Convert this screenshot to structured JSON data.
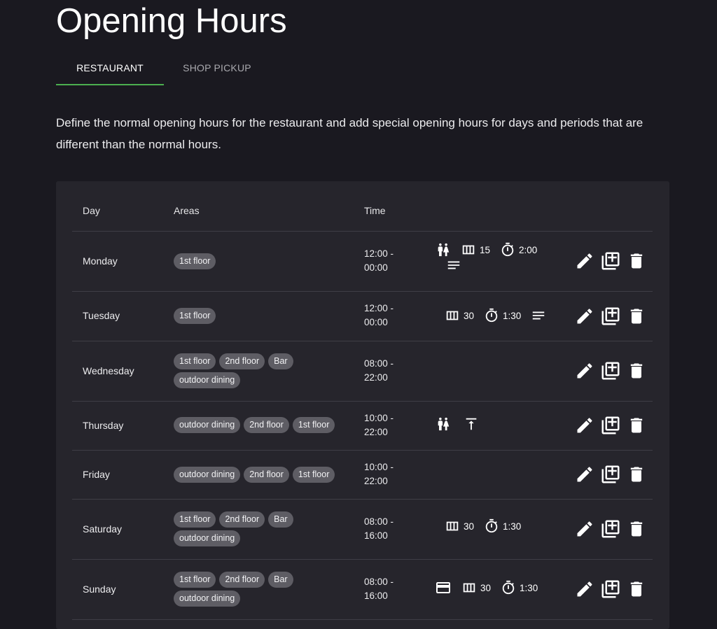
{
  "page": {
    "title": "Opening Hours",
    "description": "Define the normal opening hours for the restaurant and add special opening hours for days and periods that are different than the normal hours."
  },
  "tabs": [
    {
      "label": "RESTAURANT",
      "active": true
    },
    {
      "label": "SHOP PICKUP",
      "active": false
    }
  ],
  "colors": {
    "background": "#1a1920",
    "card": "#26252c",
    "accent": "#4caf50",
    "chip": "#5e5d64"
  },
  "table": {
    "headers": {
      "day": "Day",
      "areas": "Areas",
      "time": "Time"
    },
    "rows": [
      {
        "day": "Monday",
        "areas": [
          "1st floor"
        ],
        "time_start": "12:00 -",
        "time_end": "00:00",
        "info": {
          "guests": true,
          "tables": "15",
          "duration": "2:00",
          "notes": true
        }
      },
      {
        "day": "Tuesday",
        "areas": [
          "1st floor"
        ],
        "time_start": "12:00 -",
        "time_end": "00:00",
        "info": {
          "tables": "30",
          "duration": "1:30",
          "notes": true
        }
      },
      {
        "day": "Wednesday",
        "areas": [
          "1st floor",
          "2nd floor",
          "Bar",
          "outdoor dining"
        ],
        "time_start": "08:00 -",
        "time_end": "22:00"
      },
      {
        "day": "Thursday",
        "areas": [
          "outdoor dining",
          "2nd floor",
          "1st floor"
        ],
        "time_start": "10:00 -",
        "time_end": "22:00",
        "info": {
          "guests": true,
          "upload": true
        }
      },
      {
        "day": "Friday",
        "areas": [
          "outdoor dining",
          "2nd floor",
          "1st floor"
        ],
        "time_start": "10:00 -",
        "time_end": "22:00"
      },
      {
        "day": "Saturday",
        "areas": [
          "1st floor",
          "2nd floor",
          "Bar",
          "outdoor dining"
        ],
        "time_start": "08:00 -",
        "time_end": "16:00",
        "info": {
          "tables": "30",
          "duration": "1:30"
        }
      },
      {
        "day": "Sunday",
        "areas": [
          "1st floor",
          "2nd floor",
          "Bar",
          "outdoor dining"
        ],
        "time_start": "08:00 -",
        "time_end": "16:00",
        "info": {
          "payment": true,
          "tables": "30",
          "duration": "1:30"
        }
      }
    ]
  },
  "icons": {
    "guests": "wc-icon",
    "tables": "view-column-icon",
    "duration": "timer-icon",
    "notes": "notes-icon",
    "upload": "vertical-align-top-icon",
    "payment": "credit-card-icon",
    "edit": "pencil-icon",
    "duplicate": "library-add-icon",
    "delete": "trash-icon"
  }
}
